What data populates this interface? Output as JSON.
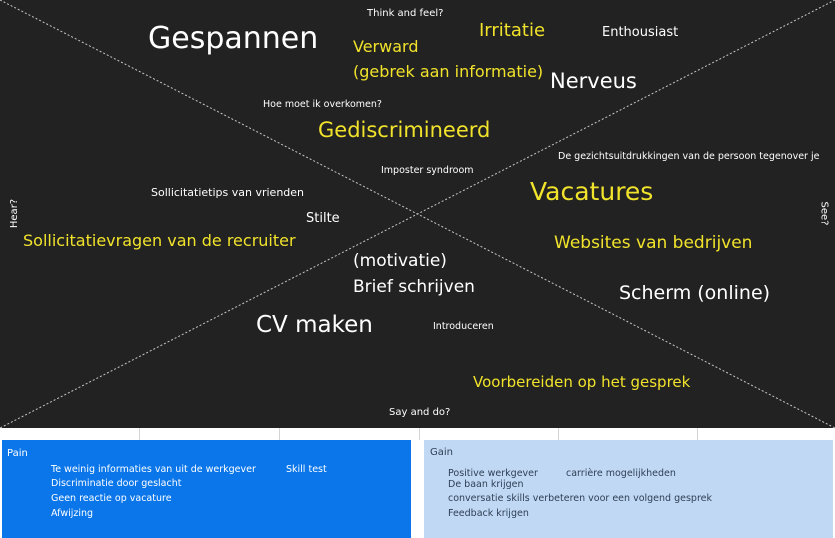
{
  "board": {
    "quadrant_labels": {
      "top": "Think and feel?",
      "bottom": "Say and do?",
      "left": "Hear?",
      "right": "See?"
    },
    "think_and_feel": {
      "gespannen": "Gespannen",
      "verward_1": "Verward",
      "verward_2": "(gebrek aan informatie)",
      "irritatie": "Irritatie",
      "enthousiast": "Enthousiast",
      "nerveus": "Nerveus",
      "hoe_overkomen": "Hoe moet ik overkomen?",
      "gediscrimineerd": "Gediscrimineerd",
      "imposter": "Imposter syndroom"
    },
    "see": {
      "gezicht": "De gezichtsuitdrukkingen van de persoon tegenover je",
      "vacatures": "Vacatures",
      "websites": "Websites van bedrijven",
      "scherm": "Scherm (online)"
    },
    "hear": {
      "tips": "Sollicitatietips van vrienden",
      "stilte": "Stilte",
      "vragen": "Sollicitatievragen van de recruiter"
    },
    "say_and_do": {
      "motivatie": "(motivatie)",
      "brief": "Brief schrijven",
      "cv": "CV maken",
      "introduceren": "Introduceren",
      "voorbereiden": "Voorbereiden op het gesprek"
    },
    "colors": {
      "background": "#222222",
      "yellow": "#f1e32b",
      "white": "#ffffff"
    }
  },
  "pain": {
    "title": "Pain",
    "items": [
      "Te weinig informaties van uit de werkgever",
      "Discriminatie door geslacht",
      "Geen reactie op vacature",
      "Afwijzing"
    ],
    "extra": "Skill test",
    "color": "#0a76ea"
  },
  "gain": {
    "title": "Gain",
    "items": [
      "Positive werkgever",
      "De baan krijgen",
      "conversatie skills verbeteren voor een volgend gesprek",
      "Feedback krijgen"
    ],
    "extra": "carrière mogelijkheden",
    "color": "#c0d8f4"
  }
}
